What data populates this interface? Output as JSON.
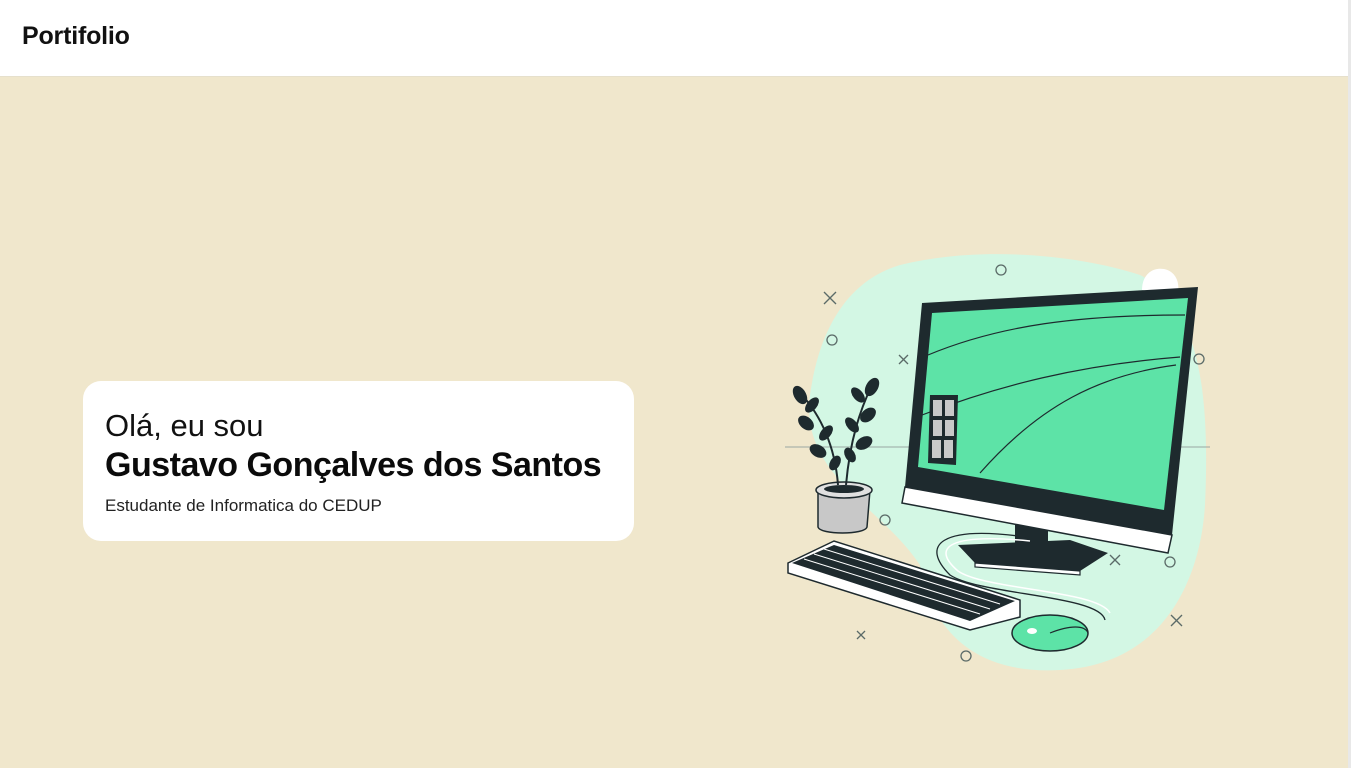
{
  "header": {
    "brand": "Portifolio"
  },
  "hero": {
    "greeting": "Olá, eu sou",
    "name": "Gustavo Gonçalves dos Santos",
    "subtitle": "Estudante de Informatica do CEDUP"
  },
  "illustration": {
    "icon": "computer-desk-illustration",
    "colors": {
      "blob": "#d3f7e4",
      "screen": "#5de3a7",
      "dark": "#1e2a2e",
      "pot": "#c8c8c8"
    }
  },
  "colors": {
    "background": "#f0e7cc",
    "header": "#ffffff",
    "card": "#ffffff",
    "accent": "#1e6fd0"
  }
}
